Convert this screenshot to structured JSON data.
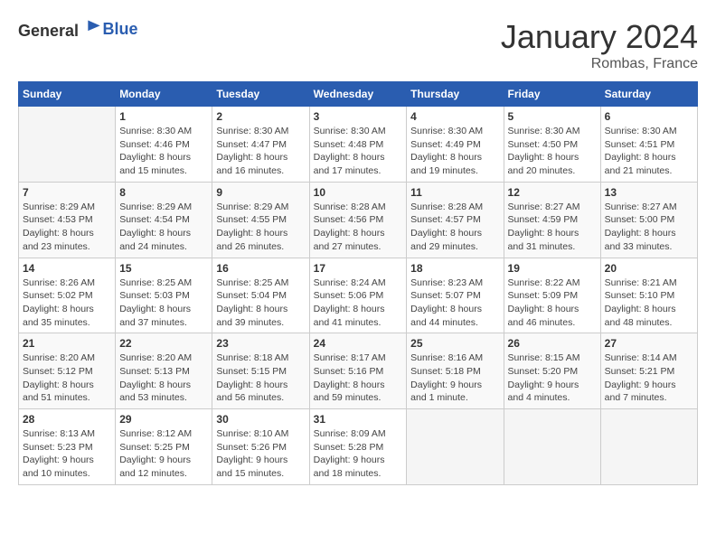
{
  "logo": {
    "text_general": "General",
    "text_blue": "Blue"
  },
  "title": "January 2024",
  "subtitle": "Rombas, France",
  "days_of_week": [
    "Sunday",
    "Monday",
    "Tuesday",
    "Wednesday",
    "Thursday",
    "Friday",
    "Saturday"
  ],
  "weeks": [
    [
      {
        "day": "",
        "sunrise": "",
        "sunset": "",
        "daylight": "",
        "empty": true
      },
      {
        "day": "1",
        "sunrise": "Sunrise: 8:30 AM",
        "sunset": "Sunset: 4:46 PM",
        "daylight": "Daylight: 8 hours and 15 minutes."
      },
      {
        "day": "2",
        "sunrise": "Sunrise: 8:30 AM",
        "sunset": "Sunset: 4:47 PM",
        "daylight": "Daylight: 8 hours and 16 minutes."
      },
      {
        "day": "3",
        "sunrise": "Sunrise: 8:30 AM",
        "sunset": "Sunset: 4:48 PM",
        "daylight": "Daylight: 8 hours and 17 minutes."
      },
      {
        "day": "4",
        "sunrise": "Sunrise: 8:30 AM",
        "sunset": "Sunset: 4:49 PM",
        "daylight": "Daylight: 8 hours and 19 minutes."
      },
      {
        "day": "5",
        "sunrise": "Sunrise: 8:30 AM",
        "sunset": "Sunset: 4:50 PM",
        "daylight": "Daylight: 8 hours and 20 minutes."
      },
      {
        "day": "6",
        "sunrise": "Sunrise: 8:30 AM",
        "sunset": "Sunset: 4:51 PM",
        "daylight": "Daylight: 8 hours and 21 minutes."
      }
    ],
    [
      {
        "day": "7",
        "sunrise": "Sunrise: 8:29 AM",
        "sunset": "Sunset: 4:53 PM",
        "daylight": "Daylight: 8 hours and 23 minutes."
      },
      {
        "day": "8",
        "sunrise": "Sunrise: 8:29 AM",
        "sunset": "Sunset: 4:54 PM",
        "daylight": "Daylight: 8 hours and 24 minutes."
      },
      {
        "day": "9",
        "sunrise": "Sunrise: 8:29 AM",
        "sunset": "Sunset: 4:55 PM",
        "daylight": "Daylight: 8 hours and 26 minutes."
      },
      {
        "day": "10",
        "sunrise": "Sunrise: 8:28 AM",
        "sunset": "Sunset: 4:56 PM",
        "daylight": "Daylight: 8 hours and 27 minutes."
      },
      {
        "day": "11",
        "sunrise": "Sunrise: 8:28 AM",
        "sunset": "Sunset: 4:57 PM",
        "daylight": "Daylight: 8 hours and 29 minutes."
      },
      {
        "day": "12",
        "sunrise": "Sunrise: 8:27 AM",
        "sunset": "Sunset: 4:59 PM",
        "daylight": "Daylight: 8 hours and 31 minutes."
      },
      {
        "day": "13",
        "sunrise": "Sunrise: 8:27 AM",
        "sunset": "Sunset: 5:00 PM",
        "daylight": "Daylight: 8 hours and 33 minutes."
      }
    ],
    [
      {
        "day": "14",
        "sunrise": "Sunrise: 8:26 AM",
        "sunset": "Sunset: 5:02 PM",
        "daylight": "Daylight: 8 hours and 35 minutes."
      },
      {
        "day": "15",
        "sunrise": "Sunrise: 8:25 AM",
        "sunset": "Sunset: 5:03 PM",
        "daylight": "Daylight: 8 hours and 37 minutes."
      },
      {
        "day": "16",
        "sunrise": "Sunrise: 8:25 AM",
        "sunset": "Sunset: 5:04 PM",
        "daylight": "Daylight: 8 hours and 39 minutes."
      },
      {
        "day": "17",
        "sunrise": "Sunrise: 8:24 AM",
        "sunset": "Sunset: 5:06 PM",
        "daylight": "Daylight: 8 hours and 41 minutes."
      },
      {
        "day": "18",
        "sunrise": "Sunrise: 8:23 AM",
        "sunset": "Sunset: 5:07 PM",
        "daylight": "Daylight: 8 hours and 44 minutes."
      },
      {
        "day": "19",
        "sunrise": "Sunrise: 8:22 AM",
        "sunset": "Sunset: 5:09 PM",
        "daylight": "Daylight: 8 hours and 46 minutes."
      },
      {
        "day": "20",
        "sunrise": "Sunrise: 8:21 AM",
        "sunset": "Sunset: 5:10 PM",
        "daylight": "Daylight: 8 hours and 48 minutes."
      }
    ],
    [
      {
        "day": "21",
        "sunrise": "Sunrise: 8:20 AM",
        "sunset": "Sunset: 5:12 PM",
        "daylight": "Daylight: 8 hours and 51 minutes."
      },
      {
        "day": "22",
        "sunrise": "Sunrise: 8:20 AM",
        "sunset": "Sunset: 5:13 PM",
        "daylight": "Daylight: 8 hours and 53 minutes."
      },
      {
        "day": "23",
        "sunrise": "Sunrise: 8:18 AM",
        "sunset": "Sunset: 5:15 PM",
        "daylight": "Daylight: 8 hours and 56 minutes."
      },
      {
        "day": "24",
        "sunrise": "Sunrise: 8:17 AM",
        "sunset": "Sunset: 5:16 PM",
        "daylight": "Daylight: 8 hours and 59 minutes."
      },
      {
        "day": "25",
        "sunrise": "Sunrise: 8:16 AM",
        "sunset": "Sunset: 5:18 PM",
        "daylight": "Daylight: 9 hours and 1 minute."
      },
      {
        "day": "26",
        "sunrise": "Sunrise: 8:15 AM",
        "sunset": "Sunset: 5:20 PM",
        "daylight": "Daylight: 9 hours and 4 minutes."
      },
      {
        "day": "27",
        "sunrise": "Sunrise: 8:14 AM",
        "sunset": "Sunset: 5:21 PM",
        "daylight": "Daylight: 9 hours and 7 minutes."
      }
    ],
    [
      {
        "day": "28",
        "sunrise": "Sunrise: 8:13 AM",
        "sunset": "Sunset: 5:23 PM",
        "daylight": "Daylight: 9 hours and 10 minutes."
      },
      {
        "day": "29",
        "sunrise": "Sunrise: 8:12 AM",
        "sunset": "Sunset: 5:25 PM",
        "daylight": "Daylight: 9 hours and 12 minutes."
      },
      {
        "day": "30",
        "sunrise": "Sunrise: 8:10 AM",
        "sunset": "Sunset: 5:26 PM",
        "daylight": "Daylight: 9 hours and 15 minutes."
      },
      {
        "day": "31",
        "sunrise": "Sunrise: 8:09 AM",
        "sunset": "Sunset: 5:28 PM",
        "daylight": "Daylight: 9 hours and 18 minutes."
      },
      {
        "day": "",
        "sunrise": "",
        "sunset": "",
        "daylight": "",
        "empty": true
      },
      {
        "day": "",
        "sunrise": "",
        "sunset": "",
        "daylight": "",
        "empty": true
      },
      {
        "day": "",
        "sunrise": "",
        "sunset": "",
        "daylight": "",
        "empty": true
      }
    ]
  ]
}
